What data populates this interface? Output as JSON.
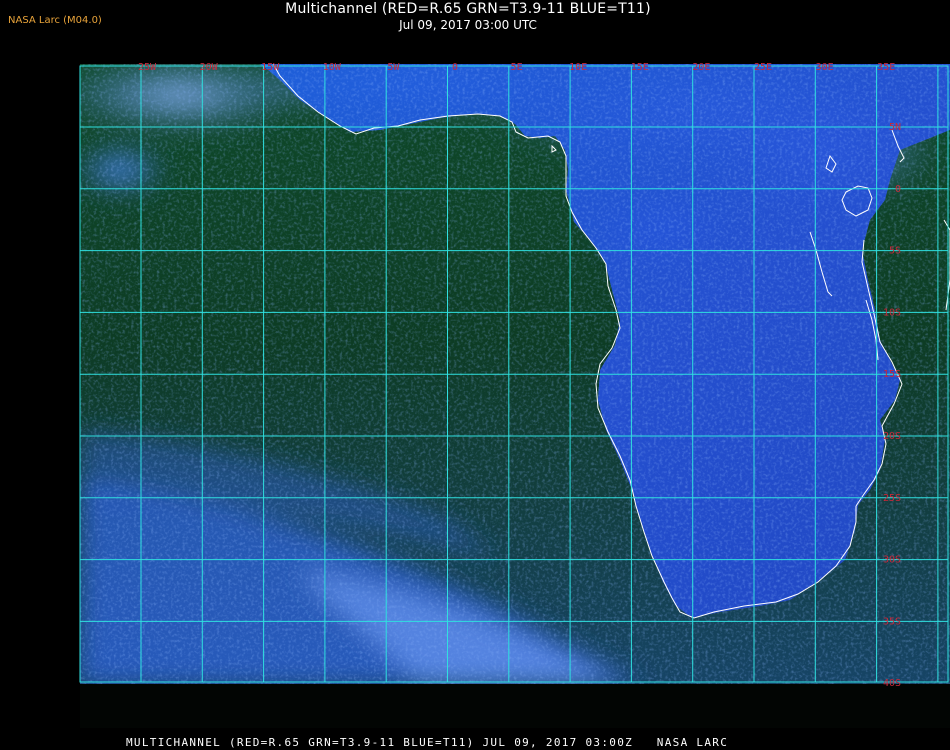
{
  "header": {
    "badge": "NASA Larc (M04.0)",
    "title": "Multichannel (RED=R.65 GRN=T3.9-11 BLUE=T11)",
    "subtitle": "Jul 09, 2017 03:00 UTC"
  },
  "footer": {
    "caption": "MULTICHANNEL (RED=R.65 GRN=T3.9-11 BLUE=T11) JUL 09, 2017 03:00Z   NASA LARC"
  },
  "map": {
    "lon_labels": [
      "25W",
      "20W",
      "15W",
      "10W",
      "5W",
      "0",
      "5E",
      "10E",
      "15E",
      "20E",
      "25E",
      "30E",
      "35E"
    ],
    "lat_labels": [
      "5N",
      "0",
      "5S",
      "10S",
      "15S",
      "20S",
      "25S",
      "30S",
      "35S",
      "40S"
    ],
    "colors": {
      "grid": "#2fe0e0",
      "label": "#c8283a",
      "coast": "#ffffff",
      "ocean": "#0c3a22",
      "cloud": "#3d7df0"
    }
  }
}
